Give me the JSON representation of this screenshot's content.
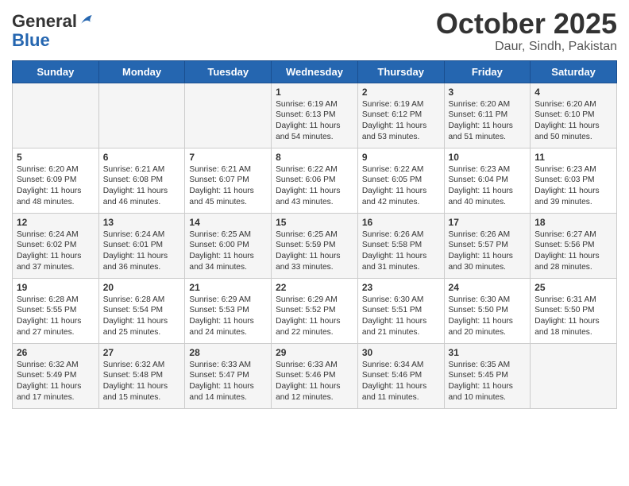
{
  "logo": {
    "general": "General",
    "blue": "Blue"
  },
  "title": "October 2025",
  "subtitle": "Daur, Sindh, Pakistan",
  "weekdays": [
    "Sunday",
    "Monday",
    "Tuesday",
    "Wednesday",
    "Thursday",
    "Friday",
    "Saturday"
  ],
  "weeks": [
    [
      {
        "day": "",
        "info": ""
      },
      {
        "day": "",
        "info": ""
      },
      {
        "day": "",
        "info": ""
      },
      {
        "day": "1",
        "info": "Sunrise: 6:19 AM\nSunset: 6:13 PM\nDaylight: 11 hours\nand 54 minutes."
      },
      {
        "day": "2",
        "info": "Sunrise: 6:19 AM\nSunset: 6:12 PM\nDaylight: 11 hours\nand 53 minutes."
      },
      {
        "day": "3",
        "info": "Sunrise: 6:20 AM\nSunset: 6:11 PM\nDaylight: 11 hours\nand 51 minutes."
      },
      {
        "day": "4",
        "info": "Sunrise: 6:20 AM\nSunset: 6:10 PM\nDaylight: 11 hours\nand 50 minutes."
      }
    ],
    [
      {
        "day": "5",
        "info": "Sunrise: 6:20 AM\nSunset: 6:09 PM\nDaylight: 11 hours\nand 48 minutes."
      },
      {
        "day": "6",
        "info": "Sunrise: 6:21 AM\nSunset: 6:08 PM\nDaylight: 11 hours\nand 46 minutes."
      },
      {
        "day": "7",
        "info": "Sunrise: 6:21 AM\nSunset: 6:07 PM\nDaylight: 11 hours\nand 45 minutes."
      },
      {
        "day": "8",
        "info": "Sunrise: 6:22 AM\nSunset: 6:06 PM\nDaylight: 11 hours\nand 43 minutes."
      },
      {
        "day": "9",
        "info": "Sunrise: 6:22 AM\nSunset: 6:05 PM\nDaylight: 11 hours\nand 42 minutes."
      },
      {
        "day": "10",
        "info": "Sunrise: 6:23 AM\nSunset: 6:04 PM\nDaylight: 11 hours\nand 40 minutes."
      },
      {
        "day": "11",
        "info": "Sunrise: 6:23 AM\nSunset: 6:03 PM\nDaylight: 11 hours\nand 39 minutes."
      }
    ],
    [
      {
        "day": "12",
        "info": "Sunrise: 6:24 AM\nSunset: 6:02 PM\nDaylight: 11 hours\nand 37 minutes."
      },
      {
        "day": "13",
        "info": "Sunrise: 6:24 AM\nSunset: 6:01 PM\nDaylight: 11 hours\nand 36 minutes."
      },
      {
        "day": "14",
        "info": "Sunrise: 6:25 AM\nSunset: 6:00 PM\nDaylight: 11 hours\nand 34 minutes."
      },
      {
        "day": "15",
        "info": "Sunrise: 6:25 AM\nSunset: 5:59 PM\nDaylight: 11 hours\nand 33 minutes."
      },
      {
        "day": "16",
        "info": "Sunrise: 6:26 AM\nSunset: 5:58 PM\nDaylight: 11 hours\nand 31 minutes."
      },
      {
        "day": "17",
        "info": "Sunrise: 6:26 AM\nSunset: 5:57 PM\nDaylight: 11 hours\nand 30 minutes."
      },
      {
        "day": "18",
        "info": "Sunrise: 6:27 AM\nSunset: 5:56 PM\nDaylight: 11 hours\nand 28 minutes."
      }
    ],
    [
      {
        "day": "19",
        "info": "Sunrise: 6:28 AM\nSunset: 5:55 PM\nDaylight: 11 hours\nand 27 minutes."
      },
      {
        "day": "20",
        "info": "Sunrise: 6:28 AM\nSunset: 5:54 PM\nDaylight: 11 hours\nand 25 minutes."
      },
      {
        "day": "21",
        "info": "Sunrise: 6:29 AM\nSunset: 5:53 PM\nDaylight: 11 hours\nand 24 minutes."
      },
      {
        "day": "22",
        "info": "Sunrise: 6:29 AM\nSunset: 5:52 PM\nDaylight: 11 hours\nand 22 minutes."
      },
      {
        "day": "23",
        "info": "Sunrise: 6:30 AM\nSunset: 5:51 PM\nDaylight: 11 hours\nand 21 minutes."
      },
      {
        "day": "24",
        "info": "Sunrise: 6:30 AM\nSunset: 5:50 PM\nDaylight: 11 hours\nand 20 minutes."
      },
      {
        "day": "25",
        "info": "Sunrise: 6:31 AM\nSunset: 5:50 PM\nDaylight: 11 hours\nand 18 minutes."
      }
    ],
    [
      {
        "day": "26",
        "info": "Sunrise: 6:32 AM\nSunset: 5:49 PM\nDaylight: 11 hours\nand 17 minutes."
      },
      {
        "day": "27",
        "info": "Sunrise: 6:32 AM\nSunset: 5:48 PM\nDaylight: 11 hours\nand 15 minutes."
      },
      {
        "day": "28",
        "info": "Sunrise: 6:33 AM\nSunset: 5:47 PM\nDaylight: 11 hours\nand 14 minutes."
      },
      {
        "day": "29",
        "info": "Sunrise: 6:33 AM\nSunset: 5:46 PM\nDaylight: 11 hours\nand 12 minutes."
      },
      {
        "day": "30",
        "info": "Sunrise: 6:34 AM\nSunset: 5:46 PM\nDaylight: 11 hours\nand 11 minutes."
      },
      {
        "day": "31",
        "info": "Sunrise: 6:35 AM\nSunset: 5:45 PM\nDaylight: 11 hours\nand 10 minutes."
      },
      {
        "day": "",
        "info": ""
      }
    ]
  ]
}
